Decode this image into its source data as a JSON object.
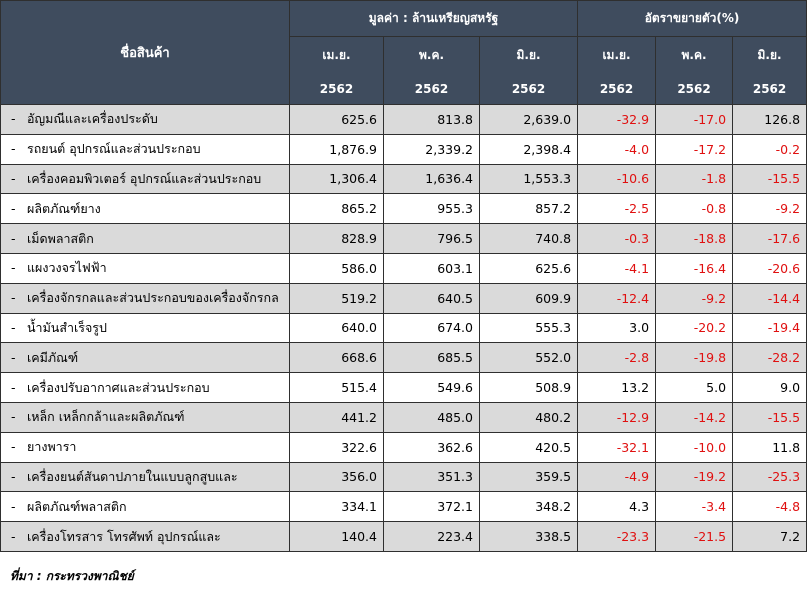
{
  "header": {
    "product_col": "ชื่อสินค้า",
    "value_group": "มูลค่า : ล้านเหรียญสหรัฐ",
    "growth_group": "อัตราขยายตัว(%)",
    "months": [
      "เม.ย.",
      "พ.ค.",
      "มิ.ย.",
      "เม.ย.",
      "พ.ค.",
      "มิ.ย."
    ],
    "years": [
      "2562",
      "2562",
      "2562",
      "2562",
      "2562",
      "2562"
    ]
  },
  "colors": {
    "header_bg": "#3f4c5e",
    "header_text": "#ffffff",
    "row_alt": "#dadada",
    "negative": "#e01010"
  },
  "rows": [
    {
      "dash": "-",
      "name": "อัญมณีและเครื่องประดับ",
      "apr": "625.6",
      "may": "813.8",
      "jun": "2,639.0",
      "g_apr": "-32.9",
      "g_may": "-17.0",
      "g_jun": "126.8"
    },
    {
      "dash": "-",
      "name": "รถยนต์ อุปกรณ์และส่วนประกอบ",
      "apr": "1,876.9",
      "may": "2,339.2",
      "jun": "2,398.4",
      "g_apr": "-4.0",
      "g_may": "-17.2",
      "g_jun": "-0.2"
    },
    {
      "dash": "-",
      "name": "เครื่องคอมพิวเตอร์ อุปกรณ์และส่วนประกอบ",
      "apr": "1,306.4",
      "may": "1,636.4",
      "jun": "1,553.3",
      "g_apr": "-10.6",
      "g_may": "-1.8",
      "g_jun": "-15.5"
    },
    {
      "dash": "-",
      "name": "ผลิตภัณฑ์ยาง",
      "apr": "865.2",
      "may": "955.3",
      "jun": "857.2",
      "g_apr": "-2.5",
      "g_may": "-0.8",
      "g_jun": "-9.2"
    },
    {
      "dash": "-",
      "name": "เม็ดพลาสติก",
      "apr": "828.9",
      "may": "796.5",
      "jun": "740.8",
      "g_apr": "-0.3",
      "g_may": "-18.8",
      "g_jun": "-17.6"
    },
    {
      "dash": "-",
      "name": "แผงวงจรไฟฟ้า",
      "apr": "586.0",
      "may": "603.1",
      "jun": "625.6",
      "g_apr": "-4.1",
      "g_may": "-16.4",
      "g_jun": "-20.6"
    },
    {
      "dash": "-",
      "name": "เครื่องจักรกลและส่วนประกอบของเครื่องจักรกล",
      "apr": "519.2",
      "may": "640.5",
      "jun": "609.9",
      "g_apr": "-12.4",
      "g_may": "-9.2",
      "g_jun": "-14.4"
    },
    {
      "dash": "-",
      "name": "น้ำมันสำเร็จรูป",
      "apr": "640.0",
      "may": "674.0",
      "jun": "555.3",
      "g_apr": "3.0",
      "g_may": "-20.2",
      "g_jun": "-19.4"
    },
    {
      "dash": "-",
      "name": "เคมีภัณฑ์",
      "apr": "668.6",
      "may": "685.5",
      "jun": "552.0",
      "g_apr": "-2.8",
      "g_may": "-19.8",
      "g_jun": "-28.2"
    },
    {
      "dash": "-",
      "name": "เครื่องปรับอากาศและส่วนประกอบ",
      "apr": "515.4",
      "may": "549.6",
      "jun": "508.9",
      "g_apr": "13.2",
      "g_may": "5.0",
      "g_jun": "9.0"
    },
    {
      "dash": "-",
      "name": "เหล็ก เหล็กกล้าและผลิตภัณฑ์",
      "apr": "441.2",
      "may": "485.0",
      "jun": "480.2",
      "g_apr": "-12.9",
      "g_may": "-14.2",
      "g_jun": "-15.5"
    },
    {
      "dash": "-",
      "name": "ยางพารา",
      "apr": "322.6",
      "may": "362.6",
      "jun": "420.5",
      "g_apr": "-32.1",
      "g_may": "-10.0",
      "g_jun": "11.8"
    },
    {
      "dash": "-",
      "name": "เครื่องยนต์สันดาปภายในแบบลูกสูบและ",
      "apr": "356.0",
      "may": "351.3",
      "jun": "359.5",
      "g_apr": "-4.9",
      "g_may": "-19.2",
      "g_jun": "-25.3"
    },
    {
      "dash": "-",
      "name": "ผลิตภัณฑ์พลาสติก",
      "apr": "334.1",
      "may": "372.1",
      "jun": "348.2",
      "g_apr": "4.3",
      "g_may": "-3.4",
      "g_jun": "-4.8"
    },
    {
      "dash": "-",
      "name": "เครื่องโทรสาร โทรศัพท์ อุปกรณ์และ",
      "apr": "140.4",
      "may": "223.4",
      "jun": "338.5",
      "g_apr": "-23.3",
      "g_may": "-21.5",
      "g_jun": "7.2"
    }
  ],
  "source": "ที่มา : กระทรวงพาณิชย์"
}
